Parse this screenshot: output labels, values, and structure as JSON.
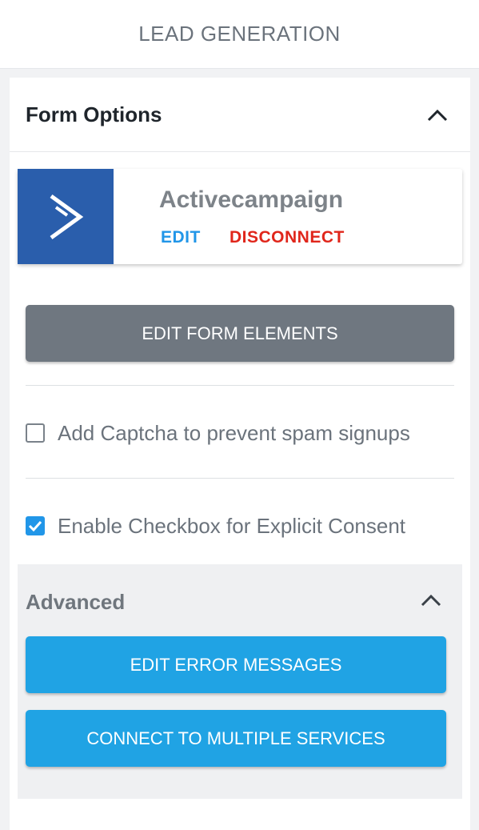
{
  "header": {
    "title": "LEAD GENERATION"
  },
  "form_options": {
    "title": "Form Options",
    "service": {
      "name": "Activecampaign",
      "edit_label": "EDIT",
      "disconnect_label": "DISCONNECT",
      "logo_color": "#2a5eac"
    },
    "edit_form_elements_label": "EDIT FORM ELEMENTS",
    "captcha": {
      "label": "Add Captcha to prevent spam signups",
      "checked": false
    },
    "consent": {
      "label": "Enable Checkbox for Explicit Consent",
      "checked": true
    }
  },
  "advanced": {
    "title": "Advanced",
    "edit_error_messages_label": "EDIT ERROR MESSAGES",
    "connect_multiple_label": "CONNECT TO MULTIPLE SERVICES"
  },
  "colors": {
    "accent_blue": "#20a3e4",
    "danger_red": "#e0261b",
    "gray_button": "#6f7780"
  }
}
